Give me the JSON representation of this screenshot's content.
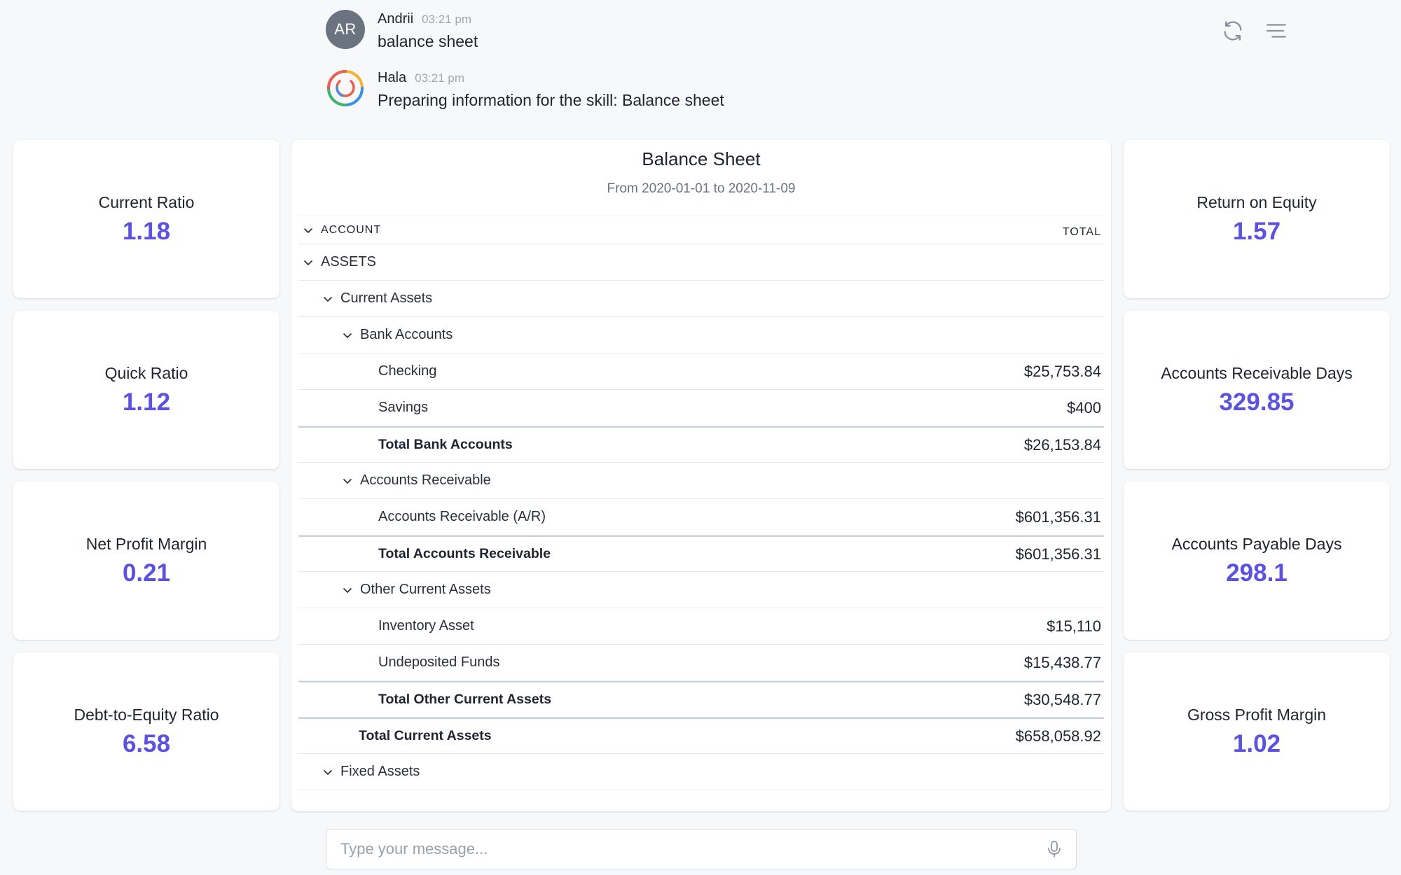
{
  "chat": {
    "messages": [
      {
        "avatar_initials": "AR",
        "author": "Andrii",
        "time": "03:21 pm",
        "text": "balance sheet"
      },
      {
        "avatar_icon": "assistant-logo-icon",
        "author": "Hala",
        "time": "03:21 pm",
        "text": "Preparing information for the skill: Balance sheet"
      }
    ]
  },
  "top_actions": {
    "refresh_icon": "refresh-icon",
    "menu_icon": "menu-icon"
  },
  "metrics_left": [
    {
      "label": "Current Ratio",
      "value": "1.18"
    },
    {
      "label": "Quick Ratio",
      "value": "1.12"
    },
    {
      "label": "Net Profit Margin",
      "value": "0.21"
    },
    {
      "label": "Debt-to-Equity Ratio",
      "value": "6.58"
    }
  ],
  "metrics_right": [
    {
      "label": "Return on Equity",
      "value": "1.57"
    },
    {
      "label": "Accounts Receivable Days",
      "value": "329.85"
    },
    {
      "label": "Accounts Payable Days",
      "value": "298.1"
    },
    {
      "label": "Gross Profit Margin",
      "value": "1.02"
    }
  ],
  "sheet": {
    "title": "Balance Sheet",
    "subtitle": "From 2020-01-01 to 2020-11-09",
    "col_account": "ACCOUNT",
    "col_total": "TOTAL",
    "rows": [
      {
        "label": "ASSETS",
        "amount": ""
      },
      {
        "label": "Current Assets",
        "amount": ""
      },
      {
        "label": "Bank Accounts",
        "amount": ""
      },
      {
        "label": "Checking",
        "amount": "$25,753.84"
      },
      {
        "label": "Savings",
        "amount": "$400"
      },
      {
        "label": "Total Bank Accounts",
        "amount": "$26,153.84"
      },
      {
        "label": "Accounts Receivable",
        "amount": ""
      },
      {
        "label": "Accounts Receivable (A/R)",
        "amount": "$601,356.31"
      },
      {
        "label": "Total Accounts Receivable",
        "amount": "$601,356.31"
      },
      {
        "label": "Other Current Assets",
        "amount": ""
      },
      {
        "label": "Inventory Asset",
        "amount": "$15,110"
      },
      {
        "label": "Undeposited Funds",
        "amount": "$15,438.77"
      },
      {
        "label": "Total Other Current Assets",
        "amount": "$30,548.77"
      },
      {
        "label": "Total Current Assets",
        "amount": "$658,058.92"
      },
      {
        "label": "Fixed Assets",
        "amount": ""
      }
    ]
  },
  "input": {
    "placeholder": "Type your message...",
    "mic_icon": "microphone-icon"
  },
  "colors": {
    "accent": "#5b52e0",
    "background": "#f7f8fa",
    "avatar_gray": "#6b7280"
  }
}
